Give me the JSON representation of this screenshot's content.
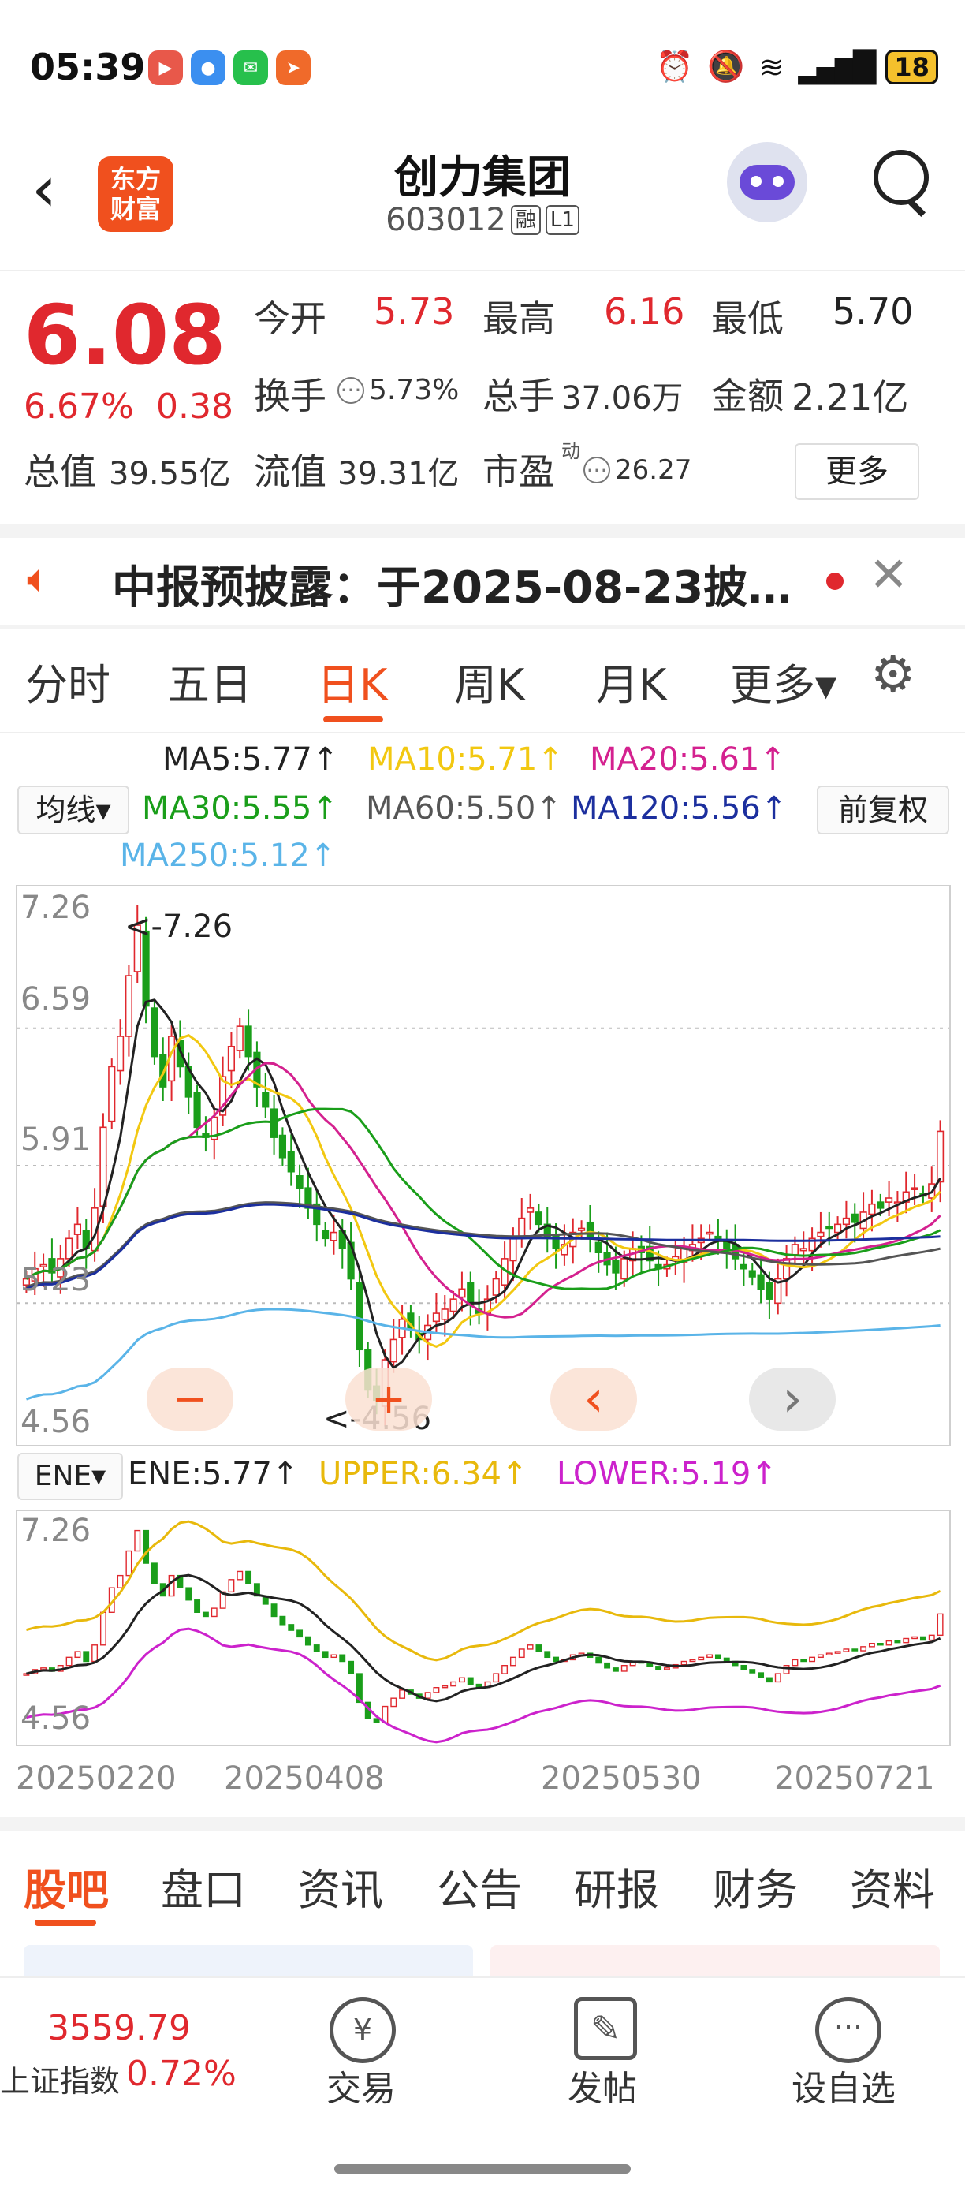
{
  "status_bar": {
    "time": "05:39",
    "battery": "18"
  },
  "header": {
    "logo_line1": "东方",
    "logo_line2": "财富",
    "title": "创力集团",
    "code": "603012",
    "tag_rong": "融",
    "tag_level": "L1"
  },
  "quote": {
    "price": "6.08",
    "change_pct": "6.67%",
    "change": "0.38",
    "open_label": "今开",
    "open": "5.73",
    "high_label": "最高",
    "high": "6.16",
    "low_label": "最低",
    "low": "5.70",
    "turnover_label": "换手",
    "turnover": "5.73%",
    "volume_label": "总手",
    "volume": "37.06万",
    "amount_label": "金额",
    "amount": "2.21亿",
    "total_mv_label": "总值",
    "total_mv": "39.55亿",
    "float_mv_label": "流值",
    "float_mv": "39.31亿",
    "pe_label": "市盈",
    "pe_superscript": "动",
    "pe": "26.27",
    "more_button": "更多"
  },
  "notice": {
    "text": "中报预披露：于2025-08-23披…"
  },
  "period_tabs": [
    "分时",
    "五日",
    "日K",
    "周K",
    "月K",
    "更多▾"
  ],
  "active_tab_index": 2,
  "ma_legend": {
    "selector": "均线▾",
    "restore": "前复权",
    "items": [
      {
        "text": "MA5:5.77↑",
        "color": "#222222"
      },
      {
        "text": "MA10:5.71↑",
        "color": "#f2c811"
      },
      {
        "text": "MA20:5.61↑",
        "color": "#d4218f"
      },
      {
        "text": "MA30:5.55↑",
        "color": "#1a9e1a"
      },
      {
        "text": "MA60:5.50↑",
        "color": "#555555"
      },
      {
        "text": "MA120:5.56↑",
        "color": "#1c2f9e"
      },
      {
        "text": "MA250:5.12↑",
        "color": "#5ab4e8"
      }
    ]
  },
  "main_chart": {
    "y_ticks": [
      "7.26",
      "6.59",
      "5.91",
      "5.23",
      "4.56"
    ],
    "max_label": "<-7.26",
    "min_label": "<-4.56",
    "controls": [
      "−",
      "+",
      "‹",
      "›"
    ]
  },
  "ene_legend": {
    "selector": "ENE▾",
    "items": [
      {
        "text": "ENE:5.77↑",
        "color": "#222222"
      },
      {
        "text": "UPPER:6.34↑",
        "color": "#e8b90c"
      },
      {
        "text": "LOWER:5.19↑",
        "color": "#cc22cc"
      }
    ]
  },
  "ene_chart": {
    "y_ticks": [
      "7.26",
      "4.56"
    ]
  },
  "date_axis": [
    "20250220",
    "20250408",
    "20250530",
    "20250721"
  ],
  "bottom_tabs": [
    "股吧",
    "盘口",
    "资讯",
    "公告",
    "研报",
    "财务",
    "资料"
  ],
  "bottom_nav": {
    "index_value": "3559.79",
    "index_name": "上证指数",
    "index_change": "0.72%",
    "trade": "交易",
    "post": "发帖",
    "watchlist": "设自选"
  },
  "colors": {
    "up": "#e0282e",
    "down": "#1a9e1a",
    "accent": "#f0501e"
  },
  "chart_data": {
    "type": "candlestick",
    "ylim": [
      4.56,
      7.26
    ],
    "x": [
      "20250220",
      "20250408",
      "20250530",
      "20250721"
    ],
    "series": [
      {
        "name": "MA5",
        "values": [
          5.77
        ]
      },
      {
        "name": "MA10",
        "values": [
          5.71
        ]
      },
      {
        "name": "MA20",
        "values": [
          5.61
        ]
      },
      {
        "name": "MA30",
        "values": [
          5.55
        ]
      },
      {
        "name": "MA60",
        "values": [
          5.5
        ]
      },
      {
        "name": "MA120",
        "values": [
          5.56
        ]
      },
      {
        "name": "MA250",
        "values": [
          5.12
        ]
      },
      {
        "name": "ENE",
        "values": [
          5.77
        ]
      },
      {
        "name": "UPPER",
        "values": [
          6.34
        ]
      },
      {
        "name": "LOWER",
        "values": [
          5.19
        ]
      }
    ],
    "closes": [
      5.35,
      5.4,
      5.42,
      5.38,
      5.45,
      5.55,
      5.62,
      5.5,
      5.7,
      6.1,
      6.4,
      6.55,
      6.85,
      7.1,
      6.7,
      6.45,
      6.3,
      6.55,
      6.4,
      6.25,
      6.1,
      6.05,
      6.15,
      6.35,
      6.5,
      6.6,
      6.45,
      6.3,
      6.2,
      6.05,
      5.95,
      5.88,
      5.8,
      5.7,
      5.62,
      5.55,
      5.58,
      5.5,
      5.35,
      5.0,
      4.8,
      4.75,
      4.95,
      5.05,
      5.15,
      5.1,
      5.05,
      5.12,
      5.18,
      5.2,
      5.25,
      5.3,
      5.22,
      5.18,
      5.25,
      5.35,
      5.45,
      5.55,
      5.65,
      5.7,
      5.62,
      5.55,
      5.5,
      5.52,
      5.58,
      5.6,
      5.55,
      5.48,
      5.42,
      5.38,
      5.45,
      5.5,
      5.48,
      5.44,
      5.4,
      5.42,
      5.46,
      5.5,
      5.52,
      5.55,
      5.58,
      5.54,
      5.5,
      5.45,
      5.4,
      5.36,
      5.3,
      5.25,
      5.35,
      5.45,
      5.52,
      5.5,
      5.55,
      5.58,
      5.6,
      5.62,
      5.65,
      5.63,
      5.68,
      5.72,
      5.7,
      5.75,
      5.73,
      5.78,
      5.8,
      5.76,
      5.82,
      6.08
    ]
  }
}
